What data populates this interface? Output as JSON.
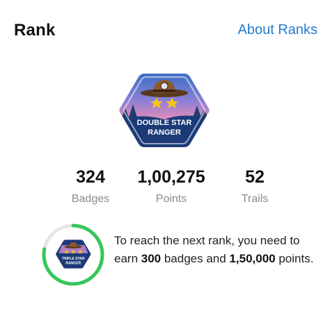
{
  "header": {
    "title": "Rank",
    "about_link": "About Ranks"
  },
  "current_badge": {
    "line1": "DOUBLE STAR",
    "line2": "RANGER",
    "stars": 2,
    "icon": "ranger-hat-badge"
  },
  "stats": {
    "badges": {
      "value": "324",
      "label": "Badges"
    },
    "points": {
      "value": "1,00,275",
      "label": "Points"
    },
    "trails": {
      "value": "52",
      "label": "Trails"
    }
  },
  "next_rank": {
    "badge_line1": "TRIPLE STAR",
    "badge_line2": "RANGER",
    "progress_fraction": 0.78,
    "text_part1": "To reach the next rank, you need to earn ",
    "badges_needed": "300",
    "text_part2": " badges and ",
    "points_needed": "1,50,000",
    "text_part3": " points."
  },
  "colors": {
    "accent": "#1f7bd0",
    "progress": "#34c759",
    "progress_track": "#e6e6e6",
    "badge_navy": "#1c3a78",
    "star": "#f5c518"
  }
}
